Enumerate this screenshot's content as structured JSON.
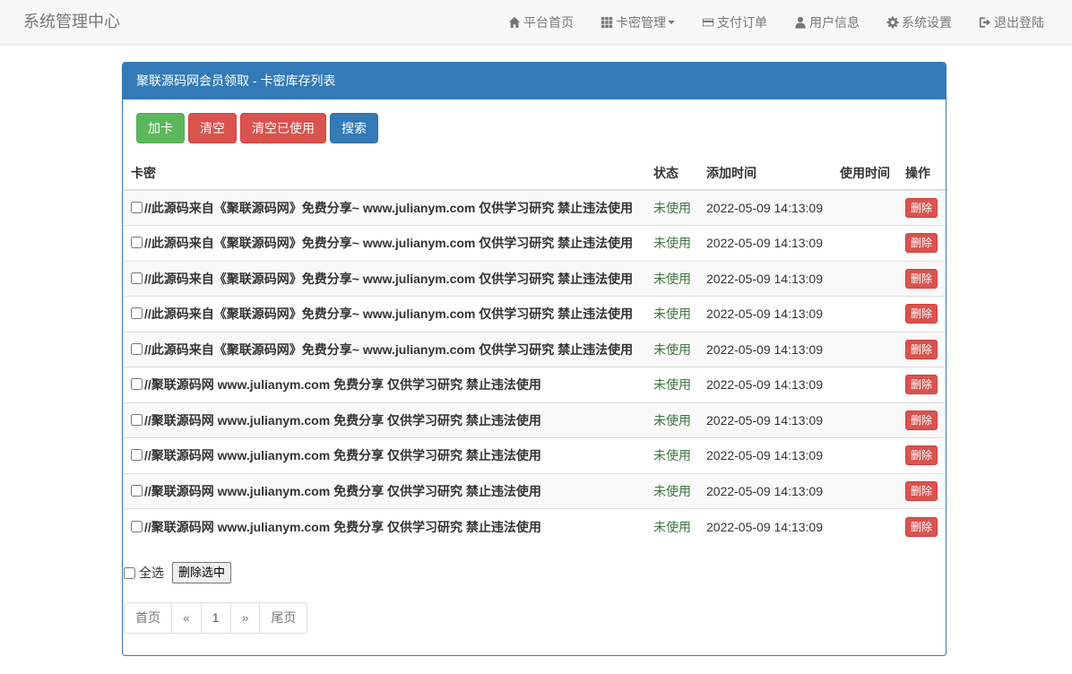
{
  "navbar": {
    "brand": "系统管理中心",
    "items": [
      {
        "label": "平台首页",
        "icon": "home-icon"
      },
      {
        "label": "卡密管理",
        "icon": "grid-icon"
      },
      {
        "label": "支付订单",
        "icon": "credit-card-icon"
      },
      {
        "label": "用户信息",
        "icon": "user-icon"
      },
      {
        "label": "系统设置",
        "icon": "gear-icon"
      },
      {
        "label": "退出登陆",
        "icon": "logout-icon"
      }
    ]
  },
  "panel": {
    "title": "聚联源码网会员领取 - 卡密库存列表",
    "buttons": {
      "add": "加卡",
      "clear": "清空",
      "clear_used": "清空已使用",
      "search": "搜索"
    },
    "columns": {
      "card": "卡密",
      "status": "状态",
      "added": "添加时间",
      "used": "使用时间",
      "action": "操作"
    },
    "rows": [
      {
        "card": "//此源码来自《聚联源码网》免费分享~ www.julianym.com 仅供学习研究 禁止违法使用",
        "status": "未使用",
        "added": "2022-05-09 14:13:09",
        "used": "",
        "action": "删除"
      },
      {
        "card": "//此源码来自《聚联源码网》免费分享~ www.julianym.com 仅供学习研究 禁止违法使用",
        "status": "未使用",
        "added": "2022-05-09 14:13:09",
        "used": "",
        "action": "删除"
      },
      {
        "card": "//此源码来自《聚联源码网》免费分享~ www.julianym.com 仅供学习研究 禁止违法使用",
        "status": "未使用",
        "added": "2022-05-09 14:13:09",
        "used": "",
        "action": "删除"
      },
      {
        "card": "//此源码来自《聚联源码网》免费分享~ www.julianym.com 仅供学习研究 禁止违法使用",
        "status": "未使用",
        "added": "2022-05-09 14:13:09",
        "used": "",
        "action": "删除"
      },
      {
        "card": "//此源码来自《聚联源码网》免费分享~ www.julianym.com 仅供学习研究 禁止违法使用",
        "status": "未使用",
        "added": "2022-05-09 14:13:09",
        "used": "",
        "action": "删除"
      },
      {
        "card": "//聚联源码网 www.julianym.com 免费分享 仅供学习研究 禁止违法使用",
        "status": "未使用",
        "added": "2022-05-09 14:13:09",
        "used": "",
        "action": "删除"
      },
      {
        "card": "//聚联源码网 www.julianym.com 免费分享 仅供学习研究 禁止违法使用",
        "status": "未使用",
        "added": "2022-05-09 14:13:09",
        "used": "",
        "action": "删除"
      },
      {
        "card": "//聚联源码网 www.julianym.com 免费分享 仅供学习研究 禁止违法使用",
        "status": "未使用",
        "added": "2022-05-09 14:13:09",
        "used": "",
        "action": "删除"
      },
      {
        "card": "//聚联源码网 www.julianym.com 免费分享 仅供学习研究 禁止违法使用",
        "status": "未使用",
        "added": "2022-05-09 14:13:09",
        "used": "",
        "action": "删除"
      },
      {
        "card": "//聚联源码网 www.julianym.com 免费分享 仅供学习研究 禁止违法使用",
        "status": "未使用",
        "added": "2022-05-09 14:13:09",
        "used": "",
        "action": "删除"
      }
    ],
    "select_all": "全选",
    "delete_selected": "删除选中",
    "pagination": {
      "first": "首页",
      "prev": "«",
      "current": "1",
      "next": "»",
      "last": "尾页"
    }
  },
  "colors": {
    "primary": "#337ab7",
    "success": "#5cb85c",
    "danger": "#d9534f",
    "status_text": "#3c763d"
  }
}
